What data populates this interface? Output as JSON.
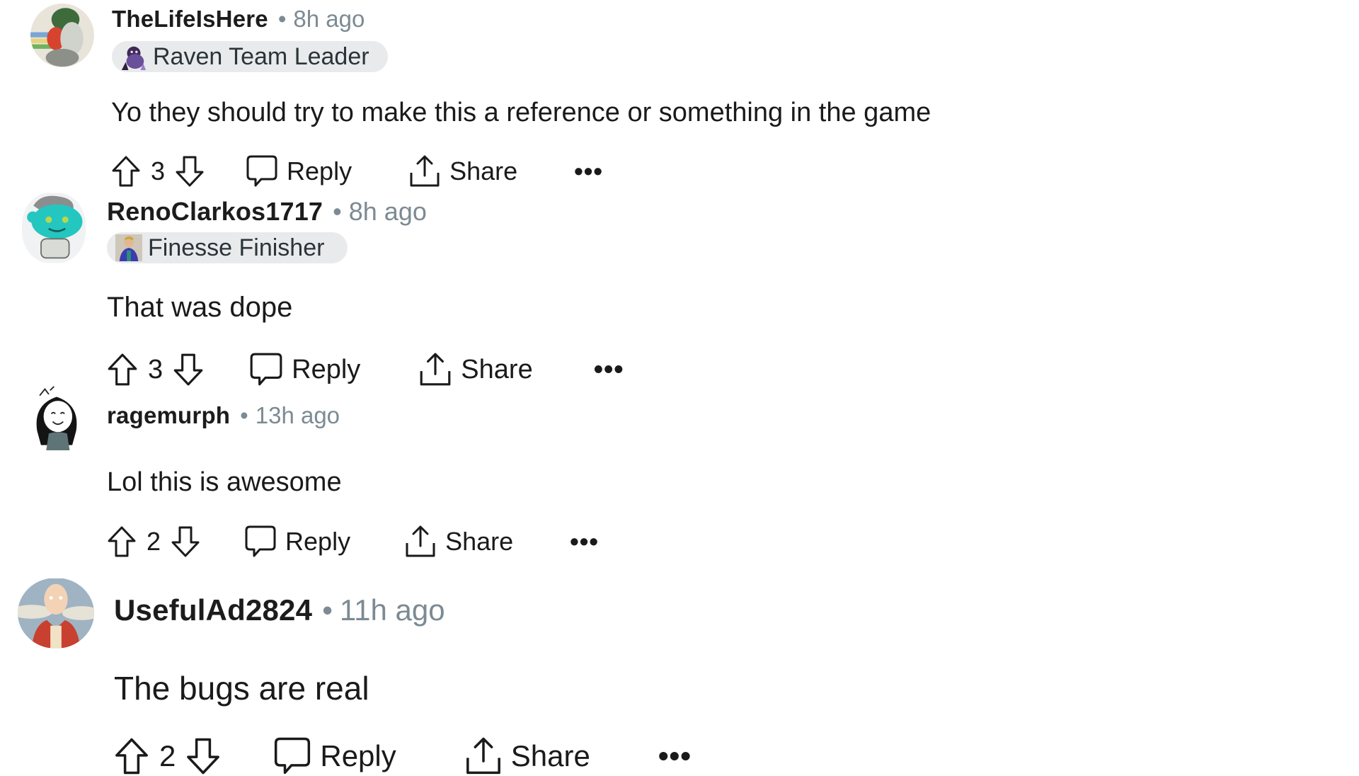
{
  "comments": [
    {
      "username": "TheLifeIsHere",
      "separator": "•",
      "time": "8h ago",
      "flair": "Raven Team Leader",
      "body": "Yo they should try to make this a reference or something in the game",
      "votes": "3",
      "reply_label": "Reply",
      "share_label": "Share",
      "more_label": "•••"
    },
    {
      "username": "RenoClarkos1717",
      "separator": "•",
      "time": "8h ago",
      "flair": "Finesse Finisher",
      "body": "That was dope",
      "votes": "3",
      "reply_label": "Reply",
      "share_label": "Share",
      "more_label": "•••"
    },
    {
      "username": "ragemurph",
      "separator": "•",
      "time": "13h ago",
      "body": "Lol this is awesome",
      "votes": "2",
      "reply_label": "Reply",
      "share_label": "Share",
      "more_label": "•••"
    },
    {
      "username": "UsefulAd2824",
      "separator": "•",
      "time": "11h ago",
      "body": "The bugs are real",
      "votes": "2",
      "reply_label": "Reply",
      "share_label": "Share",
      "more_label": "•••"
    }
  ],
  "icons": {
    "upvote": "arrow-up-outline",
    "downvote": "arrow-down-outline",
    "reply": "speech-bubble",
    "share": "share-upload",
    "more": "ellipsis"
  },
  "colors": {
    "text": "#1a1a1b",
    "meta": "#7c8a93",
    "flair_bg": "#e9eaec"
  }
}
